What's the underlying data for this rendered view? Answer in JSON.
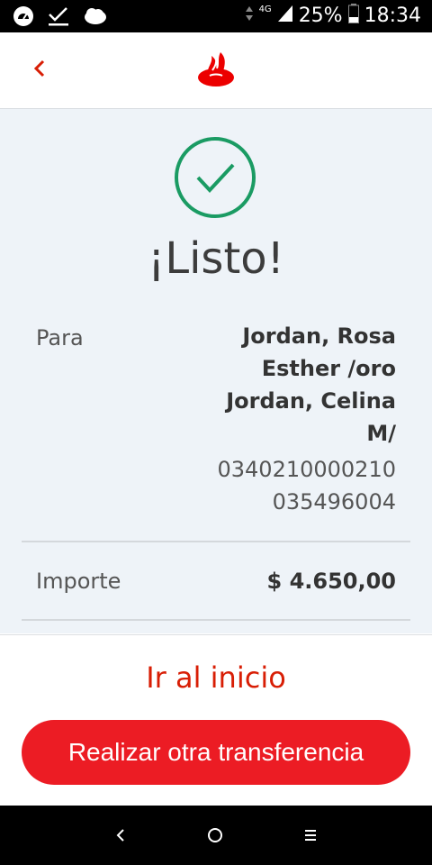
{
  "status_bar": {
    "network": "4G",
    "battery": "25%",
    "time": "18:34",
    "icons": [
      "speedometer-icon",
      "download-check-icon",
      "cloud-icon",
      "signal-icon",
      "battery-icon"
    ]
  },
  "header": {
    "back_icon": "chevron-left-icon",
    "logo": "santander-flame-logo",
    "brand_color": "#ec0000"
  },
  "confirmation": {
    "icon": "check-circle-icon",
    "accent_color": "#1a9b63",
    "title": "¡Listo!"
  },
  "details": {
    "para": {
      "label": "Para",
      "name_lines": [
        "Jordan, Rosa",
        "Esther /oro",
        "Jordan, Celina",
        "M/"
      ],
      "account_lines": [
        "0340210000210",
        "035496004"
      ]
    },
    "importe": {
      "label": "Importe",
      "value": "$ 4.650,00"
    }
  },
  "footer": {
    "link_label": "Ir al inicio",
    "primary_button_label": "Realizar otra transferencia",
    "link_color": "#d81e05",
    "button_color": "#ec1c24"
  },
  "nav": {
    "icons": [
      "nav-back-icon",
      "nav-home-icon",
      "nav-menu-icon"
    ]
  }
}
